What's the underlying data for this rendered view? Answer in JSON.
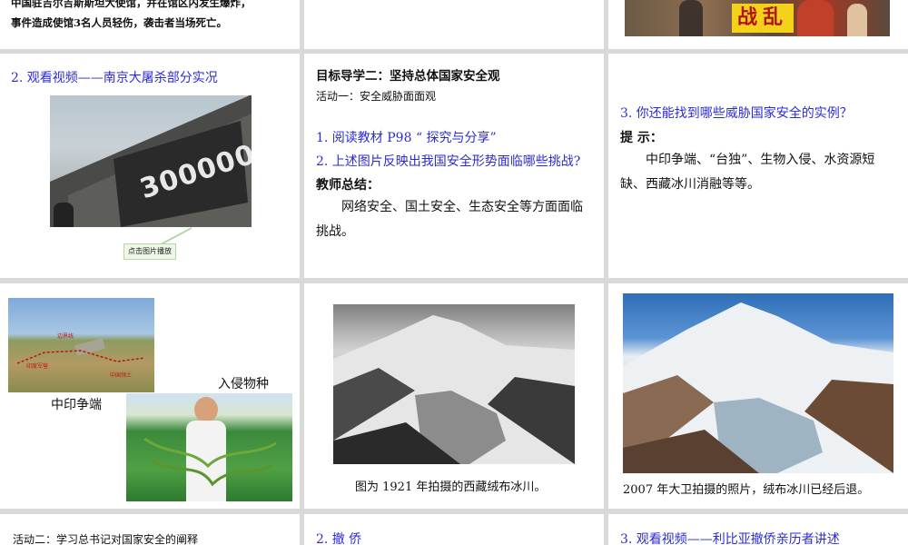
{
  "slides": {
    "s1": {
      "text_line1": "中国驻吉尔吉斯斯坦大使馆，并在馆区内发生爆炸，",
      "text_line2": "事件造成使馆3名人员轻伤，袭击者当场死亡。"
    },
    "s3": {
      "banner": "战乱"
    },
    "s4": {
      "title": "2. 观看视频——南京大屠杀部分实况",
      "wall_number": "300000",
      "play_button": "点击图片播放"
    },
    "s5": {
      "heading": "目标导学二：坚持总体国家安全观",
      "activity": "活动一：安全威胁面面观",
      "item1": "1. 阅读教材 P98 “ 探究与分享”",
      "item2": "2. 上述图片反映出我国安全形势面临哪些挑战?",
      "summary_label": "教师总结：",
      "summary_text": "网络安全、国土安全、生态安全等方面面临挑战。"
    },
    "s6": {
      "question": "3. 你还能找到哪些威胁国家安全的实例？",
      "hint_label": "提  示：",
      "hint_text": "中印争端、“台独”、生物入侵、水资源短缺、西藏冰川消融等等。"
    },
    "s7": {
      "label_border": "中印争端",
      "label_invasive": "入侵物种",
      "map_tag1": "边界线",
      "map_tag2": "印度军营",
      "map_tag3": "中国领土"
    },
    "s8": {
      "caption": "图为 1921 年拍摄的西藏绒布冰川。"
    },
    "s9": {
      "caption": "2007 年大卫拍摄的照片，绒布冰川已经后退。"
    },
    "s10": {
      "text": "活动二：学习总书记对国家安全的阐释"
    },
    "s11": {
      "text": "2. 撤  侨"
    },
    "s12": {
      "text": "3. 观看视频——利比亚撤侨亲历者讲述"
    }
  },
  "colors": {
    "background": "#d9d9d9",
    "slide": "#ffffff",
    "blue_text": "#2b2bd6",
    "banner_yellow": "#f4d21a"
  }
}
